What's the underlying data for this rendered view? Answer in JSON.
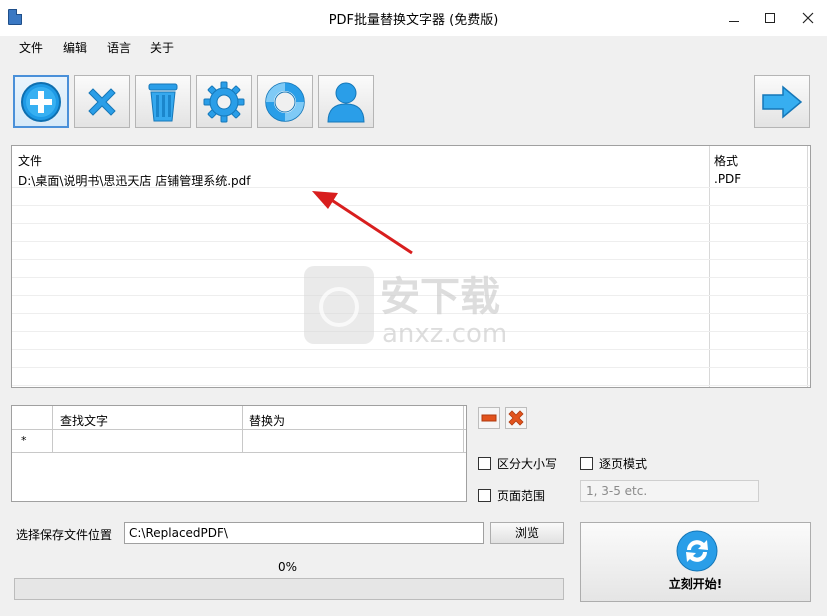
{
  "window": {
    "title": "PDF批量替换文字器 (免费版)"
  },
  "menu": {
    "items": [
      "文件",
      "编辑",
      "语言",
      "关于"
    ]
  },
  "toolbar": {
    "icons": [
      "add-icon",
      "remove-icon",
      "trash-icon",
      "settings-gear-icon",
      "help-lifebuoy-icon",
      "user-icon",
      "next-arrow-icon"
    ],
    "accent_color": "#2b9fe6"
  },
  "file_list": {
    "columns": [
      "文件",
      "格式"
    ],
    "rows": [
      {
        "file": "D:\\桌面\\说明书\\思迅天店 店铺管理系统.pdf",
        "format": ".PDF"
      }
    ]
  },
  "watermark": {
    "text": "安下载",
    "subtext": "anxz.com"
  },
  "replace_table": {
    "columns": [
      "查找文字",
      "替换为"
    ],
    "new_row_marker": "*"
  },
  "options": {
    "case_sensitive_label": "区分大小写",
    "page_by_page_label": "逐页模式",
    "page_range_label": "页面范围",
    "page_range_placeholder": "1, 3-5 etc."
  },
  "save": {
    "label": "选择保存文件位置",
    "path": "C:\\ReplacedPDF\\",
    "browse_label": "浏览"
  },
  "progress": {
    "text": "0%",
    "value": 0
  },
  "start": {
    "label": "立刻开始!"
  }
}
